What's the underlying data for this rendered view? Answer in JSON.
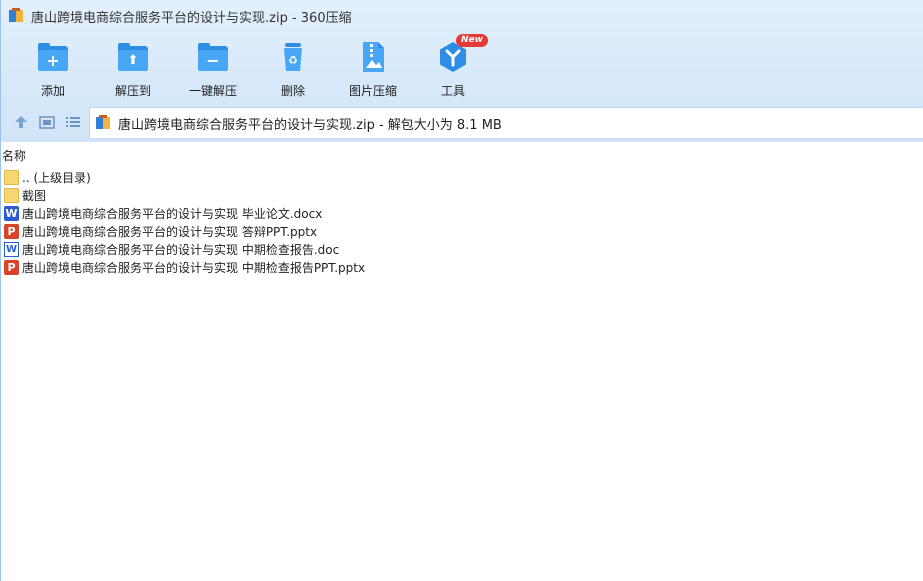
{
  "window": {
    "title": "唐山跨境电商综合服务平台的设计与实现.zip - 360压缩"
  },
  "toolbar": {
    "items": [
      {
        "label": "添加",
        "icon": "add-icon"
      },
      {
        "label": "解压到",
        "icon": "extract-to-icon"
      },
      {
        "label": "一键解压",
        "icon": "one-click-extract-icon"
      },
      {
        "label": "删除",
        "icon": "delete-icon"
      },
      {
        "label": "图片压缩",
        "icon": "image-compress-icon"
      },
      {
        "label": "工具",
        "icon": "tools-icon",
        "badge": "New"
      }
    ]
  },
  "navbar": {
    "address": "唐山跨境电商综合服务平台的设计与实现.zip - 解包大小为 8.1 MB"
  },
  "list": {
    "column_name": "名称",
    "items": [
      {
        "name": ".. (上级目录)",
        "type": "folder"
      },
      {
        "name": "截图",
        "type": "folder"
      },
      {
        "name": "唐山跨境电商综合服务平台的设计与实现 毕业论文.docx",
        "type": "docx"
      },
      {
        "name": "唐山跨境电商综合服务平台的设计与实现 答辩PPT.pptx",
        "type": "pptx"
      },
      {
        "name": "唐山跨境电商综合服务平台的设计与实现 中期检查报告.doc",
        "type": "doc"
      },
      {
        "name": "唐山跨境电商综合服务平台的设计与实现 中期检查报告PPT.pptx",
        "type": "pptx"
      }
    ]
  },
  "colors": {
    "accent": "#2e8ee6",
    "toolbar_bg": "#d6e8fa",
    "folder": "#f7d774",
    "word": "#2b5bd7",
    "ppt": "#d9432a",
    "badge": "#e63a3a"
  }
}
